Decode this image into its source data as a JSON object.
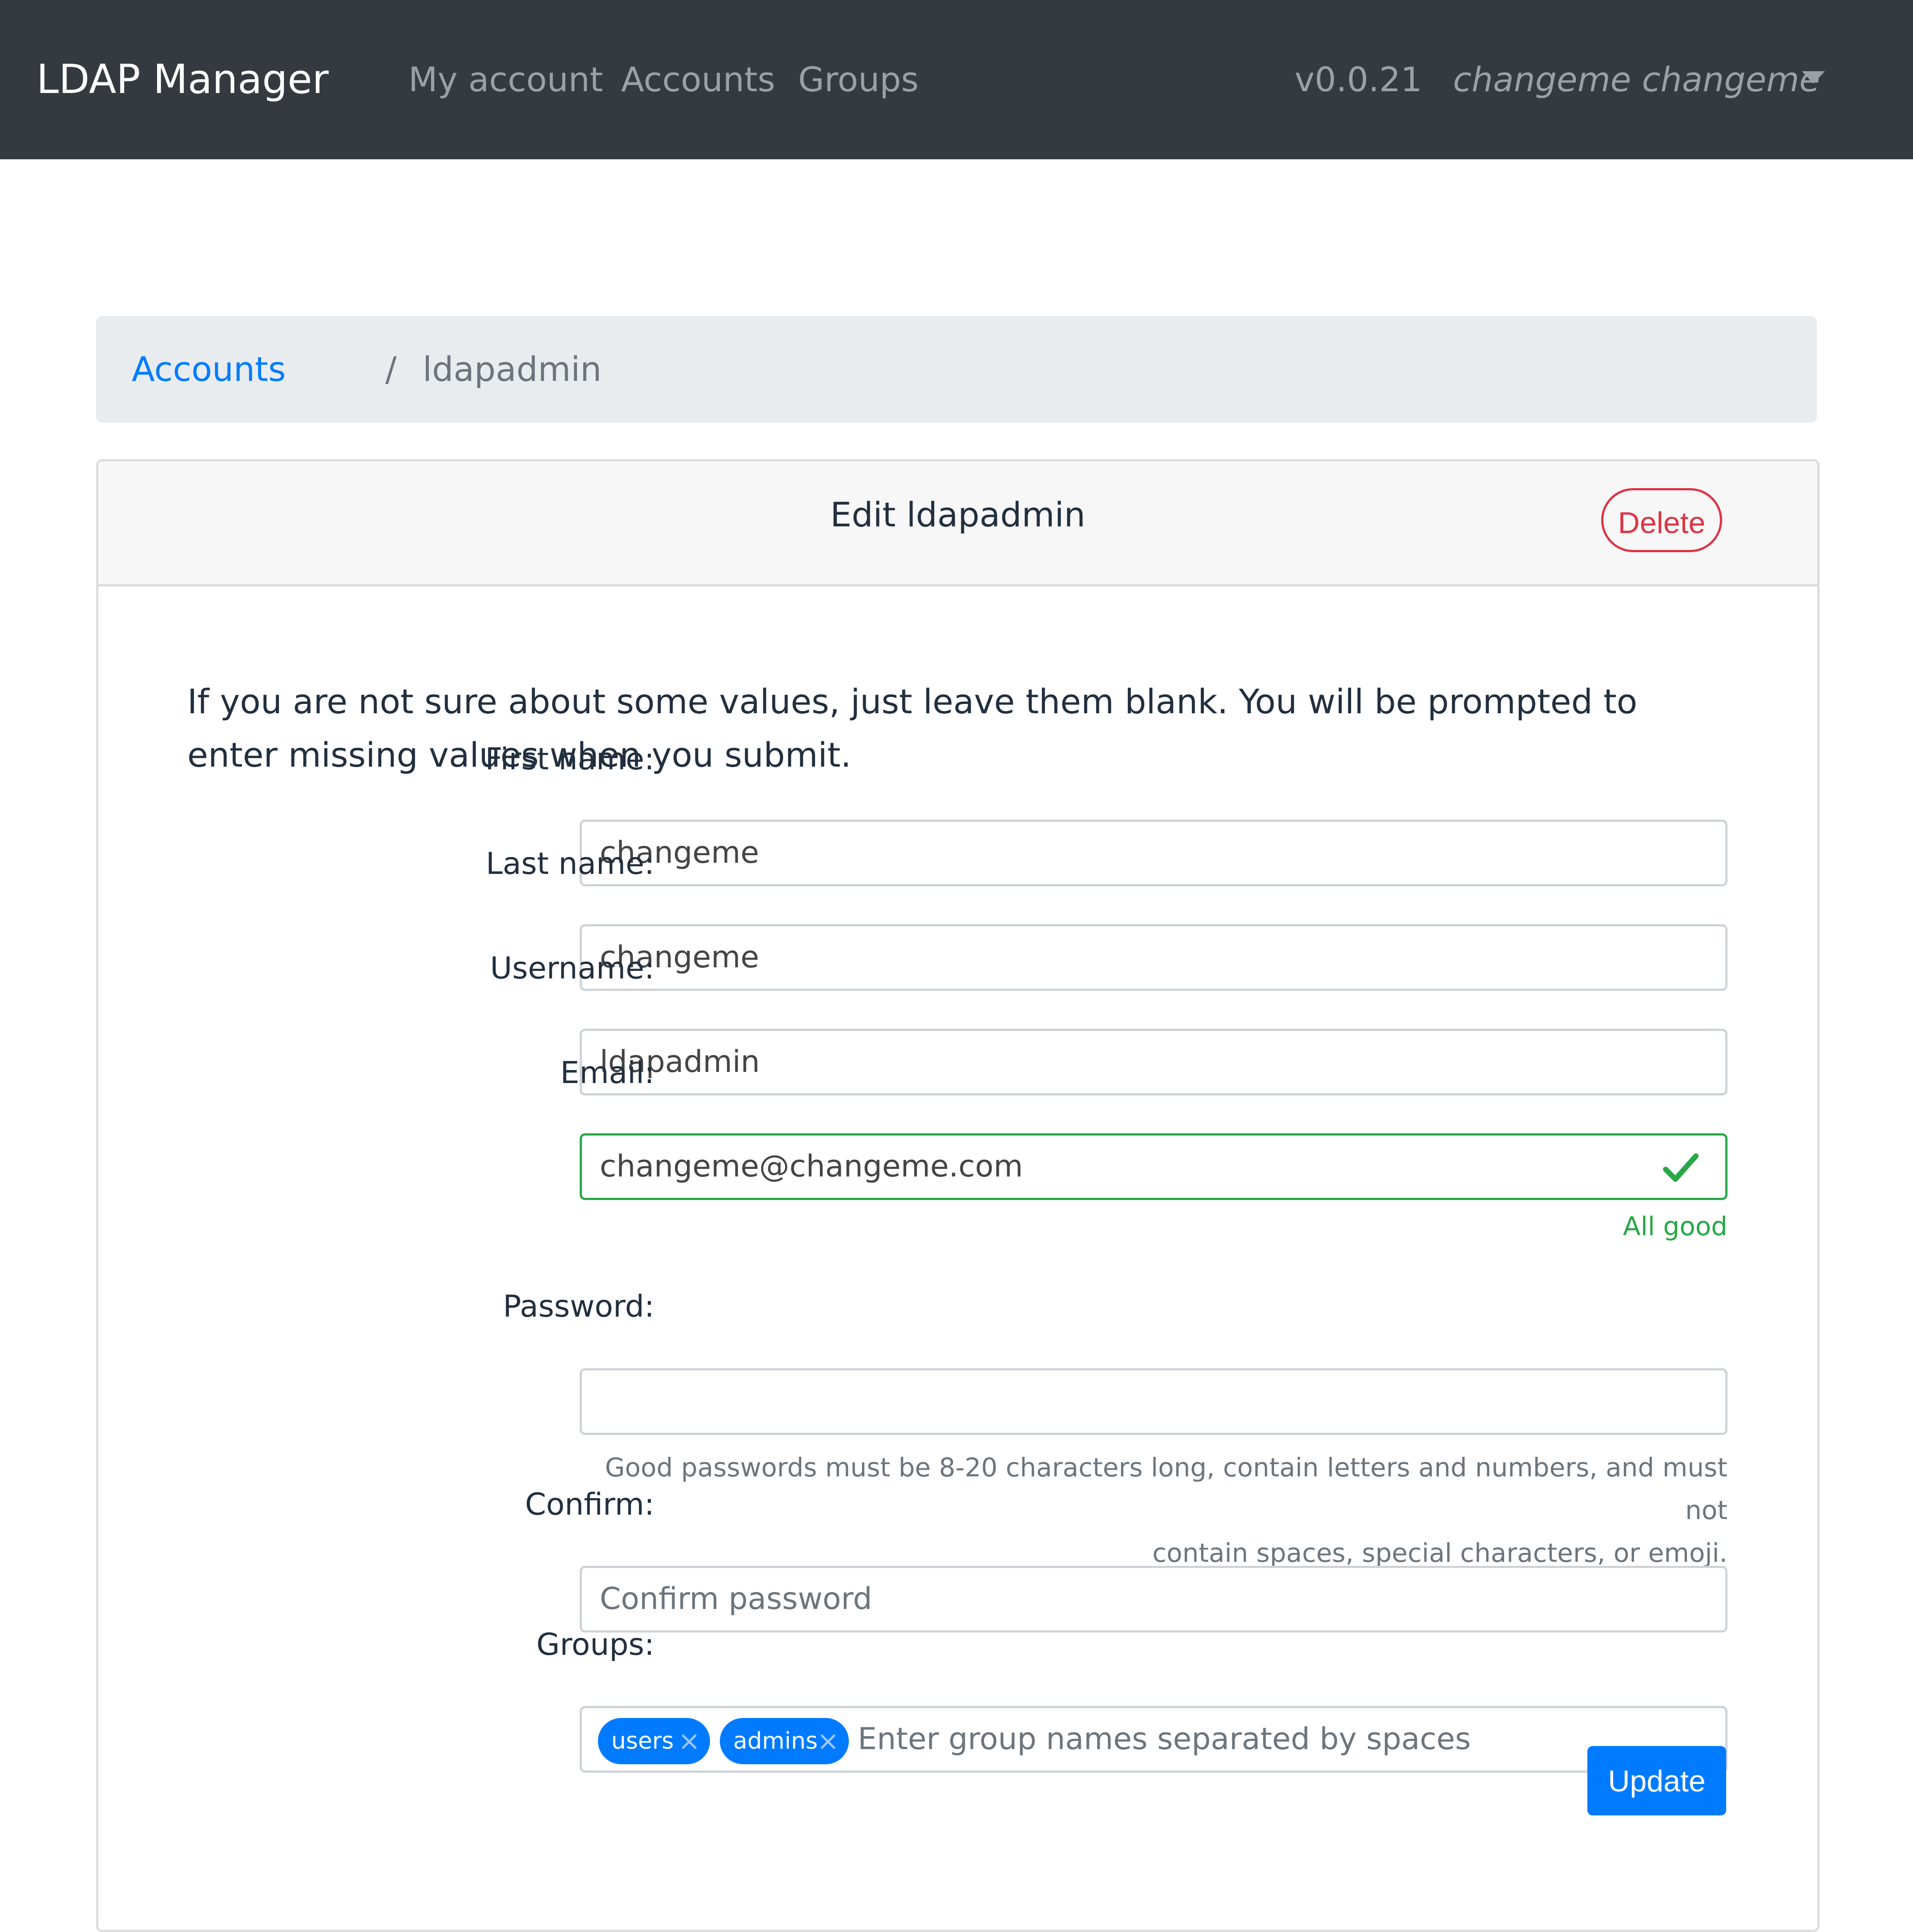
{
  "navbar": {
    "brand": "LDAP Manager",
    "links": [
      {
        "label": "My account"
      },
      {
        "label": "Accounts"
      },
      {
        "label": "Groups"
      }
    ],
    "version": "v0.0.21",
    "user": "changeme changeme",
    "user_menu_icon": "chevron-down-icon"
  },
  "breadcrumb": {
    "parent": "Accounts",
    "separator": "/",
    "current": "ldapadmin"
  },
  "card": {
    "title": "Edit ldapadmin",
    "delete_label": "Delete",
    "intro": "If you are not sure about some values, just leave them blank. You will be prompted to enter missing values when you submit."
  },
  "form": {
    "first_name": {
      "label": "First name:",
      "value": "changeme"
    },
    "last_name": {
      "label": "Last name:",
      "value": "changeme"
    },
    "username": {
      "label": "Username:",
      "value": "ldapadmin"
    },
    "email": {
      "label": "Email:",
      "value": "changeme@changeme.com",
      "feedback": "All good",
      "status_icon": "checkmark-icon"
    },
    "password": {
      "label": "Password:",
      "value": "",
      "help_line1": "Good passwords must be 8-20 characters long, contain letters and numbers, and must not",
      "help_line2": "contain spaces, special characters, or emoji."
    },
    "confirm": {
      "label": "Confirm:",
      "placeholder": "Confirm password"
    },
    "groups": {
      "label": "Groups:",
      "tags": [
        "users",
        "admins"
      ],
      "remove_icon": "×",
      "placeholder": "Enter group names separated by spaces"
    },
    "submit_label": "Update"
  },
  "colors": {
    "navbar_bg": "#343a40",
    "primary": "#007bff",
    "danger": "#dc3545",
    "success": "#28a745",
    "muted": "#6c757d"
  }
}
